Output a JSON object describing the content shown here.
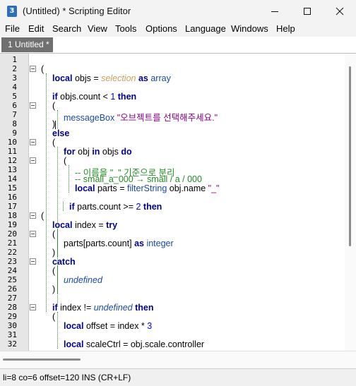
{
  "window": {
    "title": "(Untitled) * Scripting Editor",
    "icon_label": "3",
    "controls": [
      "minimize-icon",
      "maximize-icon",
      "close-icon"
    ]
  },
  "menu": {
    "items": [
      "File",
      "Edit",
      "Search",
      "View",
      "Tools",
      "Options",
      "Language",
      "Windows",
      "Help"
    ]
  },
  "tabs": [
    {
      "label": "1 Untitled *",
      "active": true
    }
  ],
  "editor": {
    "line_numbers": [
      "1",
      "2",
      "3",
      "4",
      "5",
      "6",
      "7",
      "8",
      "9",
      "10",
      "11",
      "12",
      "13",
      "14",
      "15",
      "16",
      "17",
      "18",
      "19",
      "20",
      "21",
      "22",
      "23",
      "24",
      "25",
      "26",
      "27",
      "28",
      "29",
      "30",
      "31",
      "32"
    ],
    "lines": [
      [],
      [
        {
          "t": "(",
          "c": "plain"
        }
      ],
      [
        {
          "t": "local",
          "c": "kw"
        },
        {
          "t": " objs = ",
          "c": "plain"
        },
        {
          "t": "selection",
          "c": "sel"
        },
        {
          "t": " as ",
          "c": "kw"
        },
        {
          "t": "array",
          "c": "cls"
        }
      ],
      [],
      [
        {
          "t": "if",
          "c": "kw"
        },
        {
          "t": " objs.count < ",
          "c": "plain"
        },
        {
          "t": "1",
          "c": "num"
        },
        {
          "t": " then",
          "c": "kw"
        }
      ],
      [
        {
          "t": "(",
          "c": "plain"
        }
      ],
      [
        {
          "t": "messageBox",
          "c": "fn"
        },
        {
          "t": " ",
          "c": "plain"
        },
        {
          "t": "\"오브젝트를 선택해주세요.\"",
          "c": "str"
        }
      ],
      [
        {
          "t": ")",
          "c": "plain"
        }
      ],
      [
        {
          "t": "else",
          "c": "kw"
        }
      ],
      [
        {
          "t": "(",
          "c": "plain"
        }
      ],
      [
        {
          "t": "for",
          "c": "kw"
        },
        {
          "t": " obj ",
          "c": "plain"
        },
        {
          "t": "in",
          "c": "kw"
        },
        {
          "t": " objs ",
          "c": "plain"
        },
        {
          "t": "do",
          "c": "kw"
        }
      ],
      [
        {
          "t": "(",
          "c": "plain"
        }
      ],
      [
        {
          "t": "-- 이름을 \"_\" 기준으로 분리",
          "c": "cmt"
        }
      ],
      [
        {
          "t": "-- small_a_000 → small / a / 000",
          "c": "cmt"
        }
      ],
      [
        {
          "t": "local",
          "c": "kw"
        },
        {
          "t": " parts = ",
          "c": "plain"
        },
        {
          "t": "filterString",
          "c": "fn"
        },
        {
          "t": " obj.name ",
          "c": "plain"
        },
        {
          "t": "\"_\"",
          "c": "str"
        }
      ],
      [],
      [
        {
          "t": "if",
          "c": "kw"
        },
        {
          "t": " parts.count >= ",
          "c": "plain"
        },
        {
          "t": "2",
          "c": "num"
        },
        {
          "t": " then",
          "c": "kw"
        }
      ],
      [
        {
          "t": "(",
          "c": "plain"
        }
      ],
      [
        {
          "t": "local",
          "c": "kw"
        },
        {
          "t": " index = ",
          "c": "plain"
        },
        {
          "t": "try",
          "c": "kw"
        }
      ],
      [
        {
          "t": "(",
          "c": "plain"
        }
      ],
      [
        {
          "t": "parts[parts.count] ",
          "c": "plain"
        },
        {
          "t": "as",
          "c": "kw"
        },
        {
          "t": " integer",
          "c": "cls"
        }
      ],
      [
        {
          "t": ")",
          "c": "plain"
        }
      ],
      [
        {
          "t": "catch",
          "c": "kw"
        }
      ],
      [
        {
          "t": "(",
          "c": "plain"
        }
      ],
      [
        {
          "t": "undefined",
          "c": "undef"
        }
      ],
      [
        {
          "t": ")",
          "c": "plain"
        }
      ],
      [],
      [
        {
          "t": "if",
          "c": "kw"
        },
        {
          "t": " index != ",
          "c": "plain"
        },
        {
          "t": "undefined",
          "c": "undef"
        },
        {
          "t": " then",
          "c": "kw"
        }
      ],
      [
        {
          "t": "(",
          "c": "plain"
        }
      ],
      [
        {
          "t": "local",
          "c": "kw"
        },
        {
          "t": " offset = index * ",
          "c": "plain"
        },
        {
          "t": "3",
          "c": "num"
        }
      ],
      [],
      [
        {
          "t": "local",
          "c": "kw"
        },
        {
          "t": " scaleCtrl = obj.scale.controller",
          "c": "plain"
        }
      ]
    ]
  },
  "status": {
    "text": "li=8 co=6 offset=120 INS (CR+LF)"
  }
}
